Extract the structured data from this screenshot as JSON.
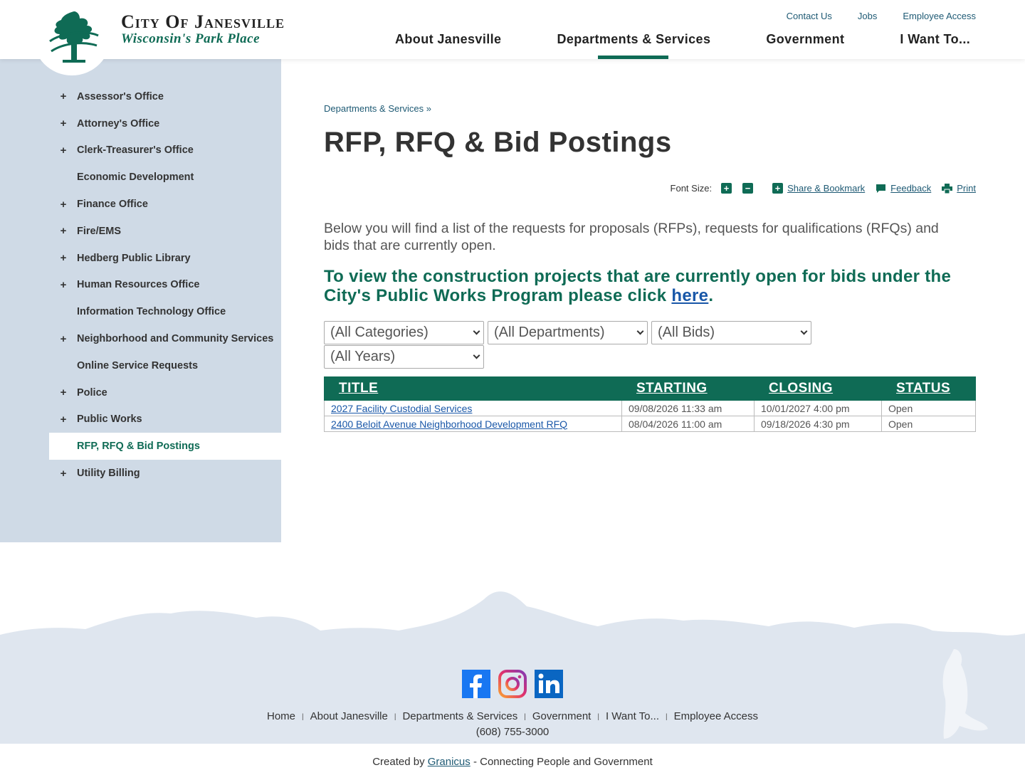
{
  "header": {
    "site_name": "City Of Janesville",
    "tagline": "Wisconsin's Park Place",
    "utility_links": [
      "Contact Us",
      "Jobs",
      "Employee Access"
    ],
    "nav": [
      "About Janesville",
      "Departments & Services",
      "Government",
      "I Want To..."
    ]
  },
  "sidebar": {
    "items": [
      {
        "label": "Assessor's Office",
        "expandable": true
      },
      {
        "label": "Attorney's Office",
        "expandable": true
      },
      {
        "label": "Clerk-Treasurer's Office",
        "expandable": true
      },
      {
        "label": "Economic Development",
        "expandable": false
      },
      {
        "label": "Finance Office",
        "expandable": true
      },
      {
        "label": "Fire/EMS",
        "expandable": true
      },
      {
        "label": "Hedberg Public Library",
        "expandable": true
      },
      {
        "label": "Human Resources Office",
        "expandable": true
      },
      {
        "label": "Information Technology Office",
        "expandable": false
      },
      {
        "label": "Neighborhood and Community Services",
        "expandable": true
      },
      {
        "label": "Online Service Requests",
        "expandable": false
      },
      {
        "label": "Police",
        "expandable": true
      },
      {
        "label": "Public Works",
        "expandable": true
      },
      {
        "label": "RFP, RFQ & Bid Postings",
        "expandable": false,
        "active": true
      },
      {
        "label": "Utility Billing",
        "expandable": true
      }
    ],
    "plus_glyph": "+"
  },
  "main": {
    "breadcrumb": "Departments & Services »",
    "title": "RFP, RFQ & Bid Postings",
    "tools": {
      "font_size_label": "Font Size:",
      "increase": "+",
      "decrease": "−",
      "share": "Share & Bookmark",
      "feedback": "Feedback",
      "print": "Print"
    },
    "intro": "Below you will find a list of the requests for proposals (RFPs), requests for qualifications (RFQs) and bids that are currently open.",
    "callout_text": "To view the construction projects that are currently open for bids under the City's Public Works Program please click ",
    "callout_link": "here",
    "callout_end": ".",
    "filters": {
      "categories": "(All Categories)",
      "departments": "(All Departments)",
      "bids": "(All Bids)",
      "years": "(All Years)"
    },
    "table": {
      "headers": [
        "TITLE",
        "STARTING",
        "CLOSING",
        "STATUS"
      ],
      "rows": [
        {
          "title": "2027 Facility Custodial Services",
          "starting": "09/08/2026 11:33 am",
          "closing": "10/01/2027 4:00 pm",
          "status": "Open"
        },
        {
          "title": "2400 Beloit Avenue Neighborhood Development RFQ",
          "starting": "08/04/2026 11:00 am",
          "closing": "09/18/2026 4:30 pm",
          "status": "Open"
        }
      ]
    }
  },
  "footer": {
    "social": [
      "facebook-icon",
      "instagram-icon",
      "linkedin-icon"
    ],
    "links": [
      "Home",
      "About Janesville",
      "Departments & Services",
      "Government",
      "I Want To...",
      "Employee Access"
    ],
    "separator": "|",
    "phone": "(608) 755-3000",
    "credit_prefix": "Created by ",
    "credit_link": "Granicus",
    "credit_suffix": " - Connecting People and Government"
  },
  "colors": {
    "brand_green": "#0f6b55",
    "sidebar_bg": "#cfdae6",
    "link_blue": "#1957a8"
  }
}
